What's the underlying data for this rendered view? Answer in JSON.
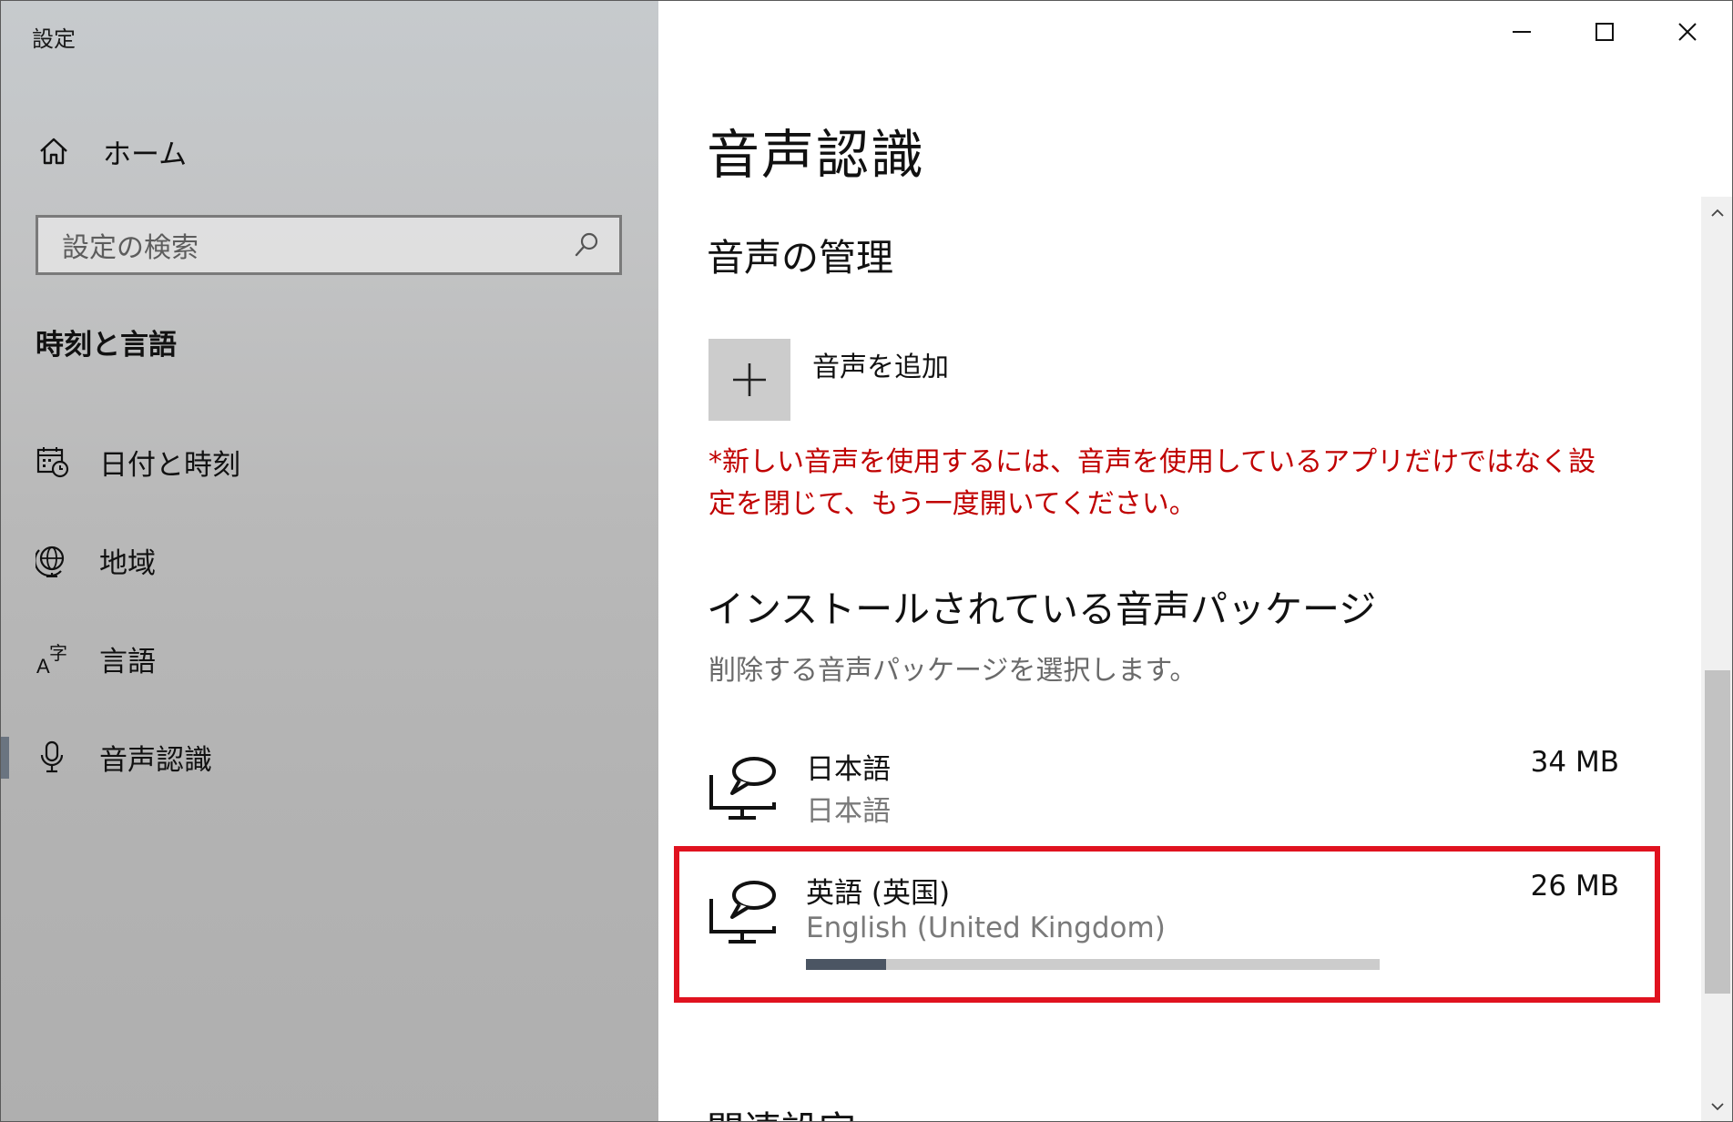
{
  "window": {
    "title": "設定",
    "controls": {
      "minimize": "minimize-icon",
      "maximize": "maximize-icon",
      "close": "close-icon"
    }
  },
  "sidebar": {
    "home_label": "ホーム",
    "search": {
      "placeholder": "設定の検索"
    },
    "section_heading": "時刻と言語",
    "items": [
      {
        "label": "日付と時刻",
        "icon": "calendar-clock-icon",
        "selected": false
      },
      {
        "label": "地域",
        "icon": "globe-icon",
        "selected": false
      },
      {
        "label": "言語",
        "icon": "language-icon",
        "selected": false
      },
      {
        "label": "音声認識",
        "icon": "microphone-icon",
        "selected": true
      }
    ]
  },
  "main": {
    "page_title": "音声認識",
    "manage_heading": "音声の管理",
    "add_voice_label": "音声を追加",
    "notice": "*新しい音声を使用するには、音声を使用しているアプリだけではなく設定を閉じて、もう一度開いてください。",
    "installed_heading": "インストールされている音声パッケージ",
    "installed_desc": "削除する音声パッケージを選択します。",
    "packages": [
      {
        "name": "日本語",
        "sub": "日本語",
        "size": "34 MB",
        "icon": "speech-monitor-icon"
      },
      {
        "name": "英語 (英国)",
        "sub": "English (United Kingdom)",
        "size": "26 MB",
        "icon": "speech-monitor-icon",
        "progress": 0.14
      }
    ],
    "related_heading": "関連設定"
  },
  "colors": {
    "notice": "#c00000",
    "highlight": "#e0121f",
    "progress_fill": "#4b5563",
    "progress_track": "#cccccc"
  }
}
